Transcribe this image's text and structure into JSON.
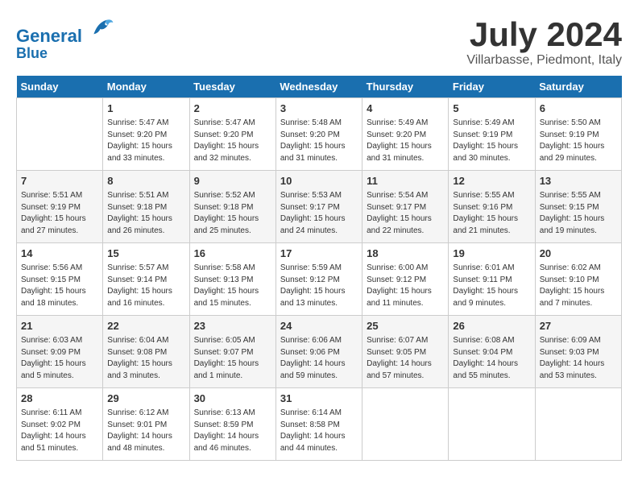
{
  "header": {
    "logo_line1": "General",
    "logo_line2": "Blue",
    "month": "July 2024",
    "location": "Villarbasse, Piedmont, Italy"
  },
  "weekdays": [
    "Sunday",
    "Monday",
    "Tuesday",
    "Wednesday",
    "Thursday",
    "Friday",
    "Saturday"
  ],
  "weeks": [
    [
      {
        "day": "",
        "info": ""
      },
      {
        "day": "1",
        "info": "Sunrise: 5:47 AM\nSunset: 9:20 PM\nDaylight: 15 hours\nand 33 minutes."
      },
      {
        "day": "2",
        "info": "Sunrise: 5:47 AM\nSunset: 9:20 PM\nDaylight: 15 hours\nand 32 minutes."
      },
      {
        "day": "3",
        "info": "Sunrise: 5:48 AM\nSunset: 9:20 PM\nDaylight: 15 hours\nand 31 minutes."
      },
      {
        "day": "4",
        "info": "Sunrise: 5:49 AM\nSunset: 9:20 PM\nDaylight: 15 hours\nand 31 minutes."
      },
      {
        "day": "5",
        "info": "Sunrise: 5:49 AM\nSunset: 9:19 PM\nDaylight: 15 hours\nand 30 minutes."
      },
      {
        "day": "6",
        "info": "Sunrise: 5:50 AM\nSunset: 9:19 PM\nDaylight: 15 hours\nand 29 minutes."
      }
    ],
    [
      {
        "day": "7",
        "info": "Sunrise: 5:51 AM\nSunset: 9:19 PM\nDaylight: 15 hours\nand 27 minutes."
      },
      {
        "day": "8",
        "info": "Sunrise: 5:51 AM\nSunset: 9:18 PM\nDaylight: 15 hours\nand 26 minutes."
      },
      {
        "day": "9",
        "info": "Sunrise: 5:52 AM\nSunset: 9:18 PM\nDaylight: 15 hours\nand 25 minutes."
      },
      {
        "day": "10",
        "info": "Sunrise: 5:53 AM\nSunset: 9:17 PM\nDaylight: 15 hours\nand 24 minutes."
      },
      {
        "day": "11",
        "info": "Sunrise: 5:54 AM\nSunset: 9:17 PM\nDaylight: 15 hours\nand 22 minutes."
      },
      {
        "day": "12",
        "info": "Sunrise: 5:55 AM\nSunset: 9:16 PM\nDaylight: 15 hours\nand 21 minutes."
      },
      {
        "day": "13",
        "info": "Sunrise: 5:55 AM\nSunset: 9:15 PM\nDaylight: 15 hours\nand 19 minutes."
      }
    ],
    [
      {
        "day": "14",
        "info": "Sunrise: 5:56 AM\nSunset: 9:15 PM\nDaylight: 15 hours\nand 18 minutes."
      },
      {
        "day": "15",
        "info": "Sunrise: 5:57 AM\nSunset: 9:14 PM\nDaylight: 15 hours\nand 16 minutes."
      },
      {
        "day": "16",
        "info": "Sunrise: 5:58 AM\nSunset: 9:13 PM\nDaylight: 15 hours\nand 15 minutes."
      },
      {
        "day": "17",
        "info": "Sunrise: 5:59 AM\nSunset: 9:12 PM\nDaylight: 15 hours\nand 13 minutes."
      },
      {
        "day": "18",
        "info": "Sunrise: 6:00 AM\nSunset: 9:12 PM\nDaylight: 15 hours\nand 11 minutes."
      },
      {
        "day": "19",
        "info": "Sunrise: 6:01 AM\nSunset: 9:11 PM\nDaylight: 15 hours\nand 9 minutes."
      },
      {
        "day": "20",
        "info": "Sunrise: 6:02 AM\nSunset: 9:10 PM\nDaylight: 15 hours\nand 7 minutes."
      }
    ],
    [
      {
        "day": "21",
        "info": "Sunrise: 6:03 AM\nSunset: 9:09 PM\nDaylight: 15 hours\nand 5 minutes."
      },
      {
        "day": "22",
        "info": "Sunrise: 6:04 AM\nSunset: 9:08 PM\nDaylight: 15 hours\nand 3 minutes."
      },
      {
        "day": "23",
        "info": "Sunrise: 6:05 AM\nSunset: 9:07 PM\nDaylight: 15 hours\nand 1 minute."
      },
      {
        "day": "24",
        "info": "Sunrise: 6:06 AM\nSunset: 9:06 PM\nDaylight: 14 hours\nand 59 minutes."
      },
      {
        "day": "25",
        "info": "Sunrise: 6:07 AM\nSunset: 9:05 PM\nDaylight: 14 hours\nand 57 minutes."
      },
      {
        "day": "26",
        "info": "Sunrise: 6:08 AM\nSunset: 9:04 PM\nDaylight: 14 hours\nand 55 minutes."
      },
      {
        "day": "27",
        "info": "Sunrise: 6:09 AM\nSunset: 9:03 PM\nDaylight: 14 hours\nand 53 minutes."
      }
    ],
    [
      {
        "day": "28",
        "info": "Sunrise: 6:11 AM\nSunset: 9:02 PM\nDaylight: 14 hours\nand 51 minutes."
      },
      {
        "day": "29",
        "info": "Sunrise: 6:12 AM\nSunset: 9:01 PM\nDaylight: 14 hours\nand 48 minutes."
      },
      {
        "day": "30",
        "info": "Sunrise: 6:13 AM\nSunset: 8:59 PM\nDaylight: 14 hours\nand 46 minutes."
      },
      {
        "day": "31",
        "info": "Sunrise: 6:14 AM\nSunset: 8:58 PM\nDaylight: 14 hours\nand 44 minutes."
      },
      {
        "day": "",
        "info": ""
      },
      {
        "day": "",
        "info": ""
      },
      {
        "day": "",
        "info": ""
      }
    ]
  ]
}
